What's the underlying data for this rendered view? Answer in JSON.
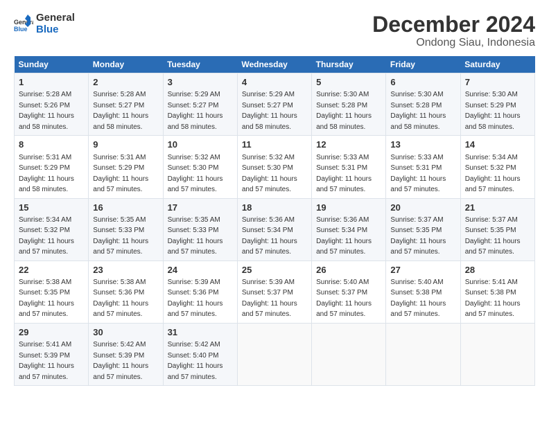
{
  "logo": {
    "line1": "General",
    "line2": "Blue"
  },
  "title": "December 2024",
  "subtitle": "Ondong Siau, Indonesia",
  "days_of_week": [
    "Sunday",
    "Monday",
    "Tuesday",
    "Wednesday",
    "Thursday",
    "Friday",
    "Saturday"
  ],
  "weeks": [
    [
      {
        "day": "1",
        "sunrise": "5:28 AM",
        "sunset": "5:26 PM",
        "daylight": "11 hours and 58 minutes."
      },
      {
        "day": "2",
        "sunrise": "5:28 AM",
        "sunset": "5:27 PM",
        "daylight": "11 hours and 58 minutes."
      },
      {
        "day": "3",
        "sunrise": "5:29 AM",
        "sunset": "5:27 PM",
        "daylight": "11 hours and 58 minutes."
      },
      {
        "day": "4",
        "sunrise": "5:29 AM",
        "sunset": "5:27 PM",
        "daylight": "11 hours and 58 minutes."
      },
      {
        "day": "5",
        "sunrise": "5:30 AM",
        "sunset": "5:28 PM",
        "daylight": "11 hours and 58 minutes."
      },
      {
        "day": "6",
        "sunrise": "5:30 AM",
        "sunset": "5:28 PM",
        "daylight": "11 hours and 58 minutes."
      },
      {
        "day": "7",
        "sunrise": "5:30 AM",
        "sunset": "5:29 PM",
        "daylight": "11 hours and 58 minutes."
      }
    ],
    [
      {
        "day": "8",
        "sunrise": "5:31 AM",
        "sunset": "5:29 PM",
        "daylight": "11 hours and 58 minutes."
      },
      {
        "day": "9",
        "sunrise": "5:31 AM",
        "sunset": "5:29 PM",
        "daylight": "11 hours and 57 minutes."
      },
      {
        "day": "10",
        "sunrise": "5:32 AM",
        "sunset": "5:30 PM",
        "daylight": "11 hours and 57 minutes."
      },
      {
        "day": "11",
        "sunrise": "5:32 AM",
        "sunset": "5:30 PM",
        "daylight": "11 hours and 57 minutes."
      },
      {
        "day": "12",
        "sunrise": "5:33 AM",
        "sunset": "5:31 PM",
        "daylight": "11 hours and 57 minutes."
      },
      {
        "day": "13",
        "sunrise": "5:33 AM",
        "sunset": "5:31 PM",
        "daylight": "11 hours and 57 minutes."
      },
      {
        "day": "14",
        "sunrise": "5:34 AM",
        "sunset": "5:32 PM",
        "daylight": "11 hours and 57 minutes."
      }
    ],
    [
      {
        "day": "15",
        "sunrise": "5:34 AM",
        "sunset": "5:32 PM",
        "daylight": "11 hours and 57 minutes."
      },
      {
        "day": "16",
        "sunrise": "5:35 AM",
        "sunset": "5:33 PM",
        "daylight": "11 hours and 57 minutes."
      },
      {
        "day": "17",
        "sunrise": "5:35 AM",
        "sunset": "5:33 PM",
        "daylight": "11 hours and 57 minutes."
      },
      {
        "day": "18",
        "sunrise": "5:36 AM",
        "sunset": "5:34 PM",
        "daylight": "11 hours and 57 minutes."
      },
      {
        "day": "19",
        "sunrise": "5:36 AM",
        "sunset": "5:34 PM",
        "daylight": "11 hours and 57 minutes."
      },
      {
        "day": "20",
        "sunrise": "5:37 AM",
        "sunset": "5:35 PM",
        "daylight": "11 hours and 57 minutes."
      },
      {
        "day": "21",
        "sunrise": "5:37 AM",
        "sunset": "5:35 PM",
        "daylight": "11 hours and 57 minutes."
      }
    ],
    [
      {
        "day": "22",
        "sunrise": "5:38 AM",
        "sunset": "5:35 PM",
        "daylight": "11 hours and 57 minutes."
      },
      {
        "day": "23",
        "sunrise": "5:38 AM",
        "sunset": "5:36 PM",
        "daylight": "11 hours and 57 minutes."
      },
      {
        "day": "24",
        "sunrise": "5:39 AM",
        "sunset": "5:36 PM",
        "daylight": "11 hours and 57 minutes."
      },
      {
        "day": "25",
        "sunrise": "5:39 AM",
        "sunset": "5:37 PM",
        "daylight": "11 hours and 57 minutes."
      },
      {
        "day": "26",
        "sunrise": "5:40 AM",
        "sunset": "5:37 PM",
        "daylight": "11 hours and 57 minutes."
      },
      {
        "day": "27",
        "sunrise": "5:40 AM",
        "sunset": "5:38 PM",
        "daylight": "11 hours and 57 minutes."
      },
      {
        "day": "28",
        "sunrise": "5:41 AM",
        "sunset": "5:38 PM",
        "daylight": "11 hours and 57 minutes."
      }
    ],
    [
      {
        "day": "29",
        "sunrise": "5:41 AM",
        "sunset": "5:39 PM",
        "daylight": "11 hours and 57 minutes."
      },
      {
        "day": "30",
        "sunrise": "5:42 AM",
        "sunset": "5:39 PM",
        "daylight": "11 hours and 57 minutes."
      },
      {
        "day": "31",
        "sunrise": "5:42 AM",
        "sunset": "5:40 PM",
        "daylight": "11 hours and 57 minutes."
      },
      null,
      null,
      null,
      null
    ]
  ],
  "labels": {
    "sunrise": "Sunrise: ",
    "sunset": "Sunset: ",
    "daylight": "Daylight: "
  }
}
